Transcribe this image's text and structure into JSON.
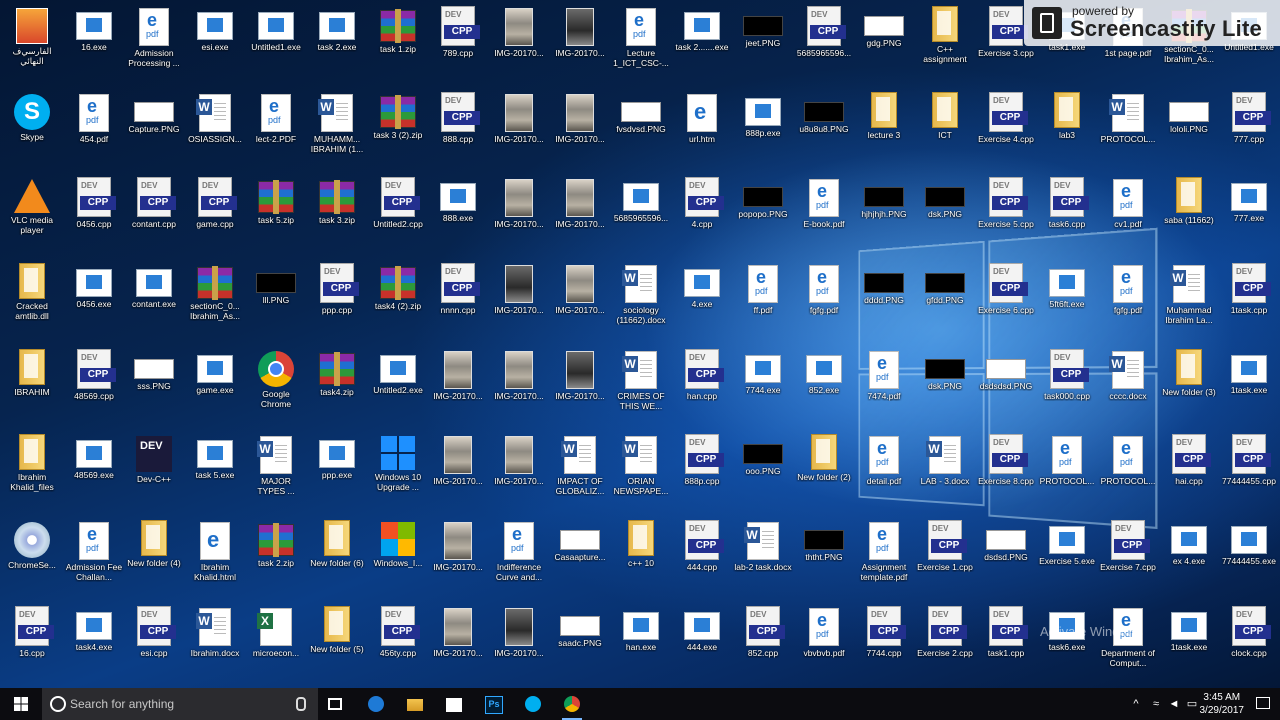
{
  "grid": {
    "columns": [
      32,
      94,
      154,
      215,
      276,
      337,
      398,
      458,
      519,
      580,
      641,
      702,
      763,
      824,
      884,
      945,
      1006,
      1067,
      1128,
      1189,
      1249
    ],
    "rows": [
      30,
      116,
      201,
      287,
      373,
      458,
      544,
      630
    ]
  },
  "desktop_icons": [
    {
      "col": 0,
      "row": 0,
      "type": "app",
      "label": "ﺍﻟﻔﺎﺭﺳﻲﻑ ﺍﻟﻨﻬﺎﺋﻲ"
    },
    {
      "col": 1,
      "row": 0,
      "type": "exe",
      "label": "16.exe"
    },
    {
      "col": 2,
      "row": 0,
      "type": "pdf",
      "label": "Admission Processing ..."
    },
    {
      "col": 3,
      "row": 0,
      "type": "exe",
      "label": "esi.exe"
    },
    {
      "col": 4,
      "row": 0,
      "type": "exe",
      "label": "Untitled1.exe"
    },
    {
      "col": 5,
      "row": 0,
      "type": "exe",
      "label": "task 2.exe"
    },
    {
      "col": 6,
      "row": 0,
      "type": "zip",
      "label": "task 1.zip"
    },
    {
      "col": 7,
      "row": 0,
      "type": "cpp",
      "label": "789.cpp"
    },
    {
      "col": 8,
      "row": 0,
      "type": "img",
      "label": "IMG-20170..."
    },
    {
      "col": 9,
      "row": 0,
      "type": "imgdark",
      "label": "IMG-20170..."
    },
    {
      "col": 10,
      "row": 0,
      "type": "pdf",
      "label": "Lecture 1_ICT_CSC-..."
    },
    {
      "col": 11,
      "row": 0,
      "type": "exe",
      "label": "task 2.......exe"
    },
    {
      "col": 12,
      "row": 0,
      "type": "pngdark",
      "label": "jeet.PNG"
    },
    {
      "col": 13,
      "row": 0,
      "type": "cpp",
      "label": "5685965596..."
    },
    {
      "col": 14,
      "row": 0,
      "type": "png",
      "label": "gdg.PNG"
    },
    {
      "col": 15,
      "row": 0,
      "type": "folder",
      "label": "C++ assignment"
    },
    {
      "col": 16,
      "row": 0,
      "type": "cpp",
      "label": "Exercise 3.cpp"
    },
    {
      "col": 17,
      "row": 0,
      "type": "exe",
      "label": "task1.exe"
    },
    {
      "col": 18,
      "row": 0,
      "type": "pdf",
      "label": "1st page.pdf"
    },
    {
      "col": 19,
      "row": 0,
      "type": "zip",
      "label": "sectionC_0... Ibrahim_As..."
    },
    {
      "col": 20,
      "row": 0,
      "type": "exe",
      "label": "Untitled1.exe"
    },
    {
      "col": 0,
      "row": 1,
      "type": "skype",
      "label": "Skype"
    },
    {
      "col": 1,
      "row": 1,
      "type": "pdf",
      "label": "454.pdf"
    },
    {
      "col": 2,
      "row": 1,
      "type": "png",
      "label": "Capture.PNG"
    },
    {
      "col": 3,
      "row": 1,
      "type": "doc",
      "label": "OSIASSIGN..."
    },
    {
      "col": 4,
      "row": 1,
      "type": "pdf",
      "label": "lect-2.PDF"
    },
    {
      "col": 5,
      "row": 1,
      "type": "doc",
      "label": "MUHAMM... IBRAHIM (1..."
    },
    {
      "col": 6,
      "row": 1,
      "type": "zip",
      "label": "task 3 (2).zip"
    },
    {
      "col": 7,
      "row": 1,
      "type": "cpp",
      "label": "888.cpp"
    },
    {
      "col": 8,
      "row": 1,
      "type": "img",
      "label": "IMG-20170..."
    },
    {
      "col": 9,
      "row": 1,
      "type": "img",
      "label": "IMG-20170..."
    },
    {
      "col": 10,
      "row": 1,
      "type": "png",
      "label": "fvsdvsd.PNG"
    },
    {
      "col": 11,
      "row": 1,
      "type": "html",
      "label": "url.htm"
    },
    {
      "col": 12,
      "row": 1,
      "type": "exe",
      "label": "888p.exe"
    },
    {
      "col": 13,
      "row": 1,
      "type": "pngdark",
      "label": "u8u8u8.PNG"
    },
    {
      "col": 14,
      "row": 1,
      "type": "folder",
      "label": "lecture 3"
    },
    {
      "col": 15,
      "row": 1,
      "type": "folder",
      "label": "ICT"
    },
    {
      "col": 16,
      "row": 1,
      "type": "cpp",
      "label": "Exercise 4.cpp"
    },
    {
      "col": 17,
      "row": 1,
      "type": "folder",
      "label": "lab3"
    },
    {
      "col": 18,
      "row": 1,
      "type": "doc",
      "label": "PROTOCOL..."
    },
    {
      "col": 19,
      "row": 1,
      "type": "png",
      "label": "lololi.PNG"
    },
    {
      "col": 20,
      "row": 1,
      "type": "cpp",
      "label": "777.cpp"
    },
    {
      "col": 0,
      "row": 2,
      "type": "vlc",
      "label": "VLC media player"
    },
    {
      "col": 1,
      "row": 2,
      "type": "cpp",
      "label": "0456.cpp"
    },
    {
      "col": 2,
      "row": 2,
      "type": "cpp",
      "label": "contant.cpp"
    },
    {
      "col": 3,
      "row": 2,
      "type": "cpp",
      "label": "game.cpp"
    },
    {
      "col": 4,
      "row": 2,
      "type": "zip",
      "label": "task 5.zip"
    },
    {
      "col": 5,
      "row": 2,
      "type": "zip",
      "label": "task 3.zip"
    },
    {
      "col": 6,
      "row": 2,
      "type": "cpp",
      "label": "Untitled2.cpp"
    },
    {
      "col": 7,
      "row": 2,
      "type": "exe",
      "label": "888.exe"
    },
    {
      "col": 8,
      "row": 2,
      "type": "img",
      "label": "IMG-20170..."
    },
    {
      "col": 9,
      "row": 2,
      "type": "img",
      "label": "IMG-20170..."
    },
    {
      "col": 10,
      "row": 2,
      "type": "exe",
      "label": "5685965596..."
    },
    {
      "col": 11,
      "row": 2,
      "type": "cpp",
      "label": "4.cpp"
    },
    {
      "col": 12,
      "row": 2,
      "type": "pngdark",
      "label": "popopo.PNG"
    },
    {
      "col": 13,
      "row": 2,
      "type": "pdf",
      "label": "E-book.pdf"
    },
    {
      "col": 14,
      "row": 2,
      "type": "pngdark",
      "label": "hjhjhjh.PNG"
    },
    {
      "col": 15,
      "row": 2,
      "type": "pngdark",
      "label": "dsk.PNG"
    },
    {
      "col": 16,
      "row": 2,
      "type": "cpp",
      "label": "Exercise 5.cpp"
    },
    {
      "col": 17,
      "row": 2,
      "type": "cpp",
      "label": "task6.cpp"
    },
    {
      "col": 18,
      "row": 2,
      "type": "pdf",
      "label": "cv1.pdf"
    },
    {
      "col": 19,
      "row": 2,
      "type": "folder",
      "label": "saba (11662)"
    },
    {
      "col": 20,
      "row": 2,
      "type": "exe",
      "label": "777.exe"
    },
    {
      "col": 0,
      "row": 3,
      "type": "folder",
      "label": "Cracked amtlib.dll"
    },
    {
      "col": 1,
      "row": 3,
      "type": "exe",
      "label": "0456.exe"
    },
    {
      "col": 2,
      "row": 3,
      "type": "exe",
      "label": "contant.exe"
    },
    {
      "col": 3,
      "row": 3,
      "type": "zip",
      "label": "sectionC_0... Ibrahim_As..."
    },
    {
      "col": 4,
      "row": 3,
      "type": "pngdark",
      "label": "lll.PNG"
    },
    {
      "col": 5,
      "row": 3,
      "type": "cpp",
      "label": "ppp.cpp"
    },
    {
      "col": 6,
      "row": 3,
      "type": "zip",
      "label": "task4 (2).zip"
    },
    {
      "col": 7,
      "row": 3,
      "type": "cpp",
      "label": "nnnn.cpp"
    },
    {
      "col": 8,
      "row": 3,
      "type": "imgdark",
      "label": "IMG-20170..."
    },
    {
      "col": 9,
      "row": 3,
      "type": "img",
      "label": "IMG-20170..."
    },
    {
      "col": 10,
      "row": 3,
      "type": "doc",
      "label": "sociology (11662).docx"
    },
    {
      "col": 11,
      "row": 3,
      "type": "exe",
      "label": "4.exe"
    },
    {
      "col": 12,
      "row": 3,
      "type": "pdf",
      "label": "ff.pdf"
    },
    {
      "col": 13,
      "row": 3,
      "type": "pdf",
      "label": "fgfg.pdf"
    },
    {
      "col": 14,
      "row": 3,
      "type": "pngdark",
      "label": "dddd.PNG"
    },
    {
      "col": 15,
      "row": 3,
      "type": "pngdark",
      "label": "gfdd.PNG"
    },
    {
      "col": 16,
      "row": 3,
      "type": "cpp",
      "label": "Exercise 6.cpp"
    },
    {
      "col": 17,
      "row": 3,
      "type": "exe",
      "label": "5ft6ft.exe"
    },
    {
      "col": 18,
      "row": 3,
      "type": "pdf",
      "label": "fgfg.pdf"
    },
    {
      "col": 19,
      "row": 3,
      "type": "doc",
      "label": "Muhammad Ibrahim La..."
    },
    {
      "col": 20,
      "row": 3,
      "type": "cpp",
      "label": "1task.cpp"
    },
    {
      "col": 0,
      "row": 4,
      "type": "folder",
      "label": "IBRAHIM"
    },
    {
      "col": 1,
      "row": 4,
      "type": "cpp",
      "label": "48569.cpp"
    },
    {
      "col": 2,
      "row": 4,
      "type": "png",
      "label": "sss.PNG"
    },
    {
      "col": 3,
      "row": 4,
      "type": "exe",
      "label": "game.exe"
    },
    {
      "col": 4,
      "row": 4,
      "type": "chrome",
      "label": "Google Chrome"
    },
    {
      "col": 5,
      "row": 4,
      "type": "zip",
      "label": "task4.zip"
    },
    {
      "col": 6,
      "row": 4,
      "type": "exe",
      "label": "Untitled2.exe"
    },
    {
      "col": 7,
      "row": 4,
      "type": "img",
      "label": "IMG-20170..."
    },
    {
      "col": 8,
      "row": 4,
      "type": "img",
      "label": "IMG-20170..."
    },
    {
      "col": 9,
      "row": 4,
      "type": "imgdark",
      "label": "IMG-20170..."
    },
    {
      "col": 10,
      "row": 4,
      "type": "doc",
      "label": "CRIMES OF THIS WE..."
    },
    {
      "col": 11,
      "row": 4,
      "type": "cpp",
      "label": "han.cpp"
    },
    {
      "col": 12,
      "row": 4,
      "type": "exe",
      "label": "7744.exe"
    },
    {
      "col": 13,
      "row": 4,
      "type": "exe",
      "label": "852.exe"
    },
    {
      "col": 14,
      "row": 4,
      "type": "pdf",
      "label": "7474.pdf"
    },
    {
      "col": 15,
      "row": 4,
      "type": "pngdark",
      "label": "dsk.PNG"
    },
    {
      "col": 16,
      "row": 4,
      "type": "png",
      "label": "dsdsdsd.PNG"
    },
    {
      "col": 17,
      "row": 4,
      "type": "cpp",
      "label": "task000.cpp"
    },
    {
      "col": 18,
      "row": 4,
      "type": "doc",
      "label": "cccc.docx"
    },
    {
      "col": 19,
      "row": 4,
      "type": "folder",
      "label": "New folder (3)"
    },
    {
      "col": 20,
      "row": 4,
      "type": "exe",
      "label": "1task.exe"
    },
    {
      "col": 0,
      "row": 5,
      "type": "folder",
      "label": "Ibrahim Khalid_files"
    },
    {
      "col": 1,
      "row": 5,
      "type": "exe",
      "label": "48569.exe"
    },
    {
      "col": 2,
      "row": 5,
      "type": "devcpp",
      "label": "Dev-C++"
    },
    {
      "col": 3,
      "row": 5,
      "type": "exe",
      "label": "task 5.exe"
    },
    {
      "col": 4,
      "row": 5,
      "type": "doc",
      "label": "MAJOR TYPES ..."
    },
    {
      "col": 5,
      "row": 5,
      "type": "exe",
      "label": "ppp.exe"
    },
    {
      "col": 6,
      "row": 5,
      "type": "winlogo",
      "label": "Windows 10 Upgrade ..."
    },
    {
      "col": 7,
      "row": 5,
      "type": "img",
      "label": "IMG-20170..."
    },
    {
      "col": 8,
      "row": 5,
      "type": "img",
      "label": "IMG-20170..."
    },
    {
      "col": 9,
      "row": 5,
      "type": "doc",
      "label": "IMPACT OF GLOBALIZ..."
    },
    {
      "col": 10,
      "row": 5,
      "type": "doc",
      "label": "ORIAN NEWSPAPE..."
    },
    {
      "col": 11,
      "row": 5,
      "type": "cpp",
      "label": "888p.cpp"
    },
    {
      "col": 12,
      "row": 5,
      "type": "pngdark",
      "label": "ooo.PNG"
    },
    {
      "col": 13,
      "row": 5,
      "type": "folder",
      "label": "New folder (2)"
    },
    {
      "col": 14,
      "row": 5,
      "type": "pdf",
      "label": "detail.pdf"
    },
    {
      "col": 15,
      "row": 5,
      "type": "doc",
      "label": "LAB - 3.docx"
    },
    {
      "col": 16,
      "row": 5,
      "type": "cpp",
      "label": "Exercise 8.cpp"
    },
    {
      "col": 17,
      "row": 5,
      "type": "pdf",
      "label": "PROTOCOL..."
    },
    {
      "col": 18,
      "row": 5,
      "type": "pdf",
      "label": "PROTOCOL..."
    },
    {
      "col": 19,
      "row": 5,
      "type": "cpp",
      "label": "hai.cpp"
    },
    {
      "col": 20,
      "row": 5,
      "type": "cpp",
      "label": "77444455.cpp"
    },
    {
      "col": 0,
      "row": 6,
      "type": "cd",
      "label": "ChromeSe..."
    },
    {
      "col": 1,
      "row": 6,
      "type": "pdf",
      "label": "Admission Fee Challan..."
    },
    {
      "col": 2,
      "row": 6,
      "type": "folder",
      "label": "New folder (4)"
    },
    {
      "col": 3,
      "row": 6,
      "type": "html",
      "label": "Ibrahim Khalid.html"
    },
    {
      "col": 4,
      "row": 6,
      "type": "zip",
      "label": "task 2.zip"
    },
    {
      "col": 5,
      "row": 6,
      "type": "folder",
      "label": "New folder (6)"
    },
    {
      "col": 6,
      "row": 6,
      "type": "winflag",
      "label": "Windows_I..."
    },
    {
      "col": 7,
      "row": 6,
      "type": "img",
      "label": "IMG-20170..."
    },
    {
      "col": 8,
      "row": 6,
      "type": "pdf",
      "label": "Indifference Curve and..."
    },
    {
      "col": 9,
      "row": 6,
      "type": "png",
      "label": "Casaapture..."
    },
    {
      "col": 10,
      "row": 6,
      "type": "folder",
      "label": "c++ 10"
    },
    {
      "col": 11,
      "row": 6,
      "type": "cpp",
      "label": "444.cpp"
    },
    {
      "col": 12,
      "row": 6,
      "type": "doc",
      "label": "lab-2 task.docx"
    },
    {
      "col": 13,
      "row": 6,
      "type": "pngdark",
      "label": "ththt.PNG"
    },
    {
      "col": 14,
      "row": 6,
      "type": "pdf",
      "label": "Assignment template.pdf"
    },
    {
      "col": 15,
      "row": 6,
      "type": "cpp",
      "label": "Exercise 1.cpp"
    },
    {
      "col": 16,
      "row": 6,
      "type": "png",
      "label": "dsdsd.PNG"
    },
    {
      "col": 17,
      "row": 6,
      "type": "exe",
      "label": "Exercise 5.exe"
    },
    {
      "col": 18,
      "row": 6,
      "type": "cpp",
      "label": "Exercise 7.cpp"
    },
    {
      "col": 19,
      "row": 6,
      "type": "exe",
      "label": "ex 4.exe"
    },
    {
      "col": 20,
      "row": 6,
      "type": "exe",
      "label": "77444455.exe"
    },
    {
      "col": 0,
      "row": 7,
      "type": "cpp",
      "label": "16.cpp"
    },
    {
      "col": 1,
      "row": 7,
      "type": "exe",
      "label": "task4.exe"
    },
    {
      "col": 2,
      "row": 7,
      "type": "cpp",
      "label": "esi.cpp"
    },
    {
      "col": 3,
      "row": 7,
      "type": "doc",
      "label": "Ibrahim.docx"
    },
    {
      "col": 4,
      "row": 7,
      "type": "xls",
      "label": "microecon..."
    },
    {
      "col": 5,
      "row": 7,
      "type": "folder",
      "label": "New folder (5)"
    },
    {
      "col": 6,
      "row": 7,
      "type": "cpp",
      "label": "456ty.cpp"
    },
    {
      "col": 7,
      "row": 7,
      "type": "img",
      "label": "IMG-20170..."
    },
    {
      "col": 8,
      "row": 7,
      "type": "imgdark",
      "label": "IMG-20170..."
    },
    {
      "col": 9,
      "row": 7,
      "type": "png",
      "label": "saadc.PNG"
    },
    {
      "col": 10,
      "row": 7,
      "type": "exe",
      "label": "han.exe"
    },
    {
      "col": 11,
      "row": 7,
      "type": "exe",
      "label": "444.exe"
    },
    {
      "col": 12,
      "row": 7,
      "type": "cpp",
      "label": "852.cpp"
    },
    {
      "col": 13,
      "row": 7,
      "type": "pdf",
      "label": "vbvbvb.pdf"
    },
    {
      "col": 14,
      "row": 7,
      "type": "cpp",
      "label": "7744.cpp"
    },
    {
      "col": 15,
      "row": 7,
      "type": "cpp",
      "label": "Exercise 2.cpp"
    },
    {
      "col": 16,
      "row": 7,
      "type": "cpp",
      "label": "task1.cpp"
    },
    {
      "col": 17,
      "row": 7,
      "type": "exe",
      "label": "task6.exe"
    },
    {
      "col": 18,
      "row": 7,
      "type": "pdf",
      "label": "Department of Comput..."
    },
    {
      "col": 19,
      "row": 7,
      "type": "exe",
      "label": "1task.exe"
    },
    {
      "col": 20,
      "row": 7,
      "type": "cpp",
      "label": "clock.cpp"
    }
  ],
  "watermark": {
    "small": "powered by",
    "big": "Screencastify Lite"
  },
  "activate_text": "Activate Windows",
  "taskbar": {
    "search_placeholder": "Search for anything",
    "pinned": [
      {
        "id": "tb-taskview",
        "icon": "task-view-icon"
      },
      {
        "id": "tb-edge",
        "icon": "edge-icon"
      },
      {
        "id": "tb-explorer",
        "icon": "file-explorer-icon"
      },
      {
        "id": "tb-store",
        "icon": "store-icon"
      },
      {
        "id": "tb-photoshop",
        "icon": "photoshop-icon",
        "text": "Ps"
      },
      {
        "id": "tb-skype",
        "icon": "skype-icon"
      },
      {
        "id": "tb-chrome",
        "icon": "chrome-icon",
        "active": true
      }
    ],
    "clock_time": "3:45 AM",
    "clock_date": "3/29/2017"
  }
}
